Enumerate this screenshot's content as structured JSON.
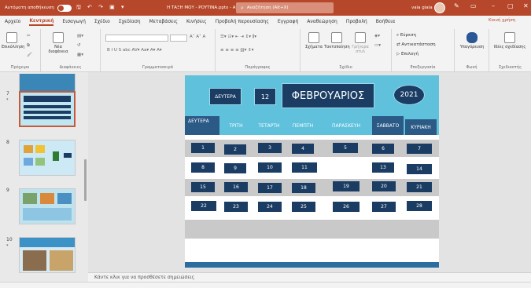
{
  "titlebar": {
    "autosave": "Αυτόματη αποθήκευση",
    "autosave_state": "",
    "file": "Η ΤΑΞΗ ΜΟΥ - ΡΟΥΤΙΝΑ.pptx - Αποθηκεύτηκε",
    "search_placeholder": "Αναζήτηση (Alt+X)",
    "user": "vaia giala"
  },
  "tabs": [
    "Αρχείο",
    "Κεντρική",
    "Εισαγωγή",
    "Σχέδιο",
    "Σχεδίαση",
    "Μεταβάσεις",
    "Κινήσεις",
    "Προβολή παρουσίασης",
    "Εγγραφή",
    "Αναθεώρηση",
    "Προβολή",
    "Βοήθεια"
  ],
  "share": "Κοινή χρήση",
  "ribbon": {
    "paste": "Επικόλληση",
    "clipboard": "Πρόχειρο",
    "new_slide": "Νέα διαφάνεια",
    "slides": "Διαφάνειες",
    "font": "Γραμματοσειρά",
    "paragraph": "Παράγραφος",
    "shapes": "Σχήματα",
    "arrange": "Τακτοποίηση",
    "quick_styles": "Γρήγορα στυλ",
    "drawing": "Σχέδιο",
    "find": "Εύρεση",
    "replace": "Αντικατάσταση",
    "select": "Επιλογή",
    "editing": "Επεξεργασία",
    "dictate": "Υπαγόρευση",
    "voice": "Φωνή",
    "ideas": "Ιδέες σχεδίασης",
    "designer": "Σχεδιαστής"
  },
  "thumbs": [
    {
      "num": "7",
      "star": "*"
    },
    {
      "num": "8",
      "star": ""
    },
    {
      "num": "9",
      "star": ""
    },
    {
      "num": "10",
      "star": "*"
    }
  ],
  "slide": {
    "day": "ΔΕΥΤΕΡΑ",
    "date": "12",
    "month": "ΦΕΒΡΟΥΑΡΙΟΣ",
    "year": "2021",
    "weekdays": [
      "ΔΕΥΤΕΡΑ",
      "ΤΡΙΤΗ",
      "ΤΕΤΑΡΤΗ",
      "ΠΕΜΠΤΗ",
      "ΠΑΡΑΣΚΕΥΗ",
      "ΣΑΒΒΑΤΟ",
      "ΚΥΡΙΑΚΗ"
    ],
    "weeks": [
      [
        "1",
        "2",
        "3",
        "4",
        "5",
        "6",
        "7"
      ],
      [
        "8",
        "9",
        "10",
        "11",
        "",
        "13",
        "14"
      ],
      [
        "15",
        "16",
        "17",
        "18",
        "19",
        "20",
        "21"
      ],
      [
        "22",
        "23",
        "24",
        "25",
        "26",
        "27",
        "28"
      ]
    ]
  },
  "notes": "Κάντε κλικ για να προσθέσετε σημειώσεις"
}
